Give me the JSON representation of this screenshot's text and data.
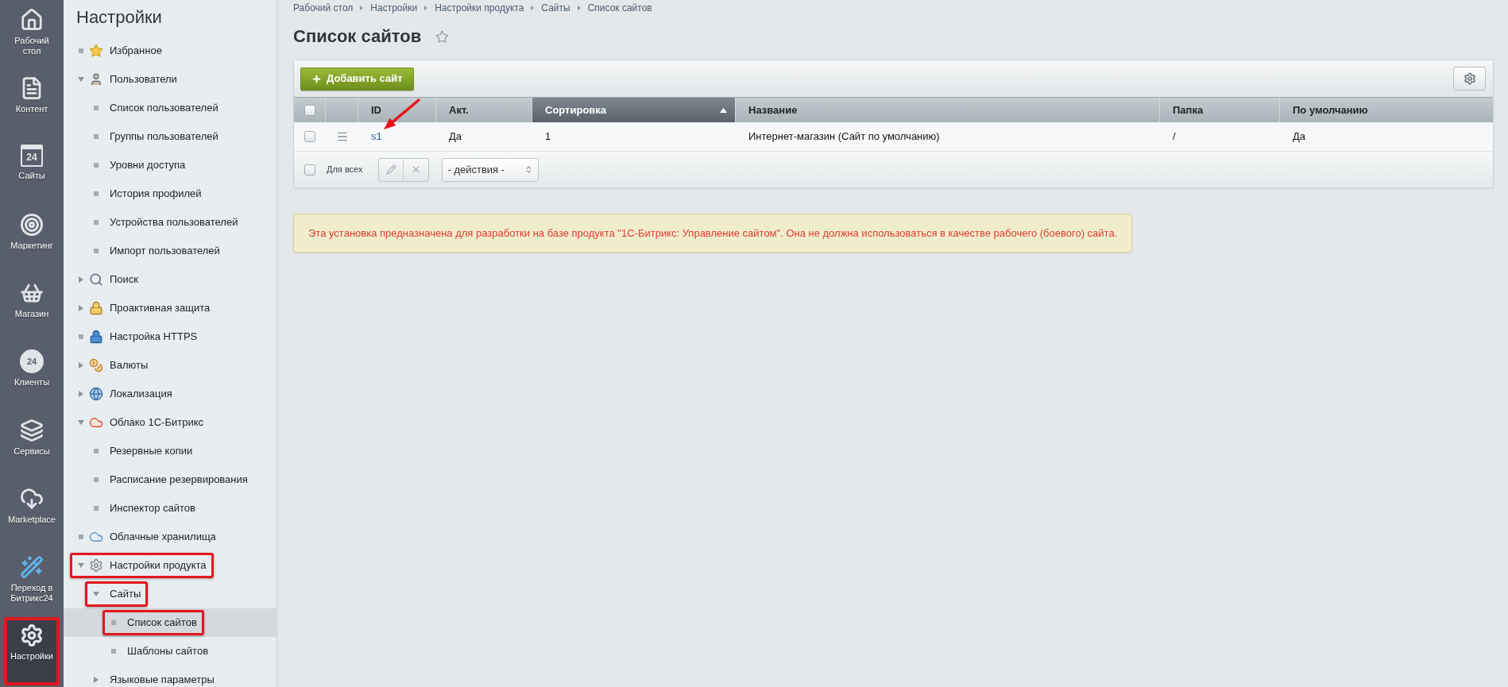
{
  "app_sidebar": {
    "items": [
      {
        "label": "Рабочий стол",
        "selected": false,
        "framed": false
      },
      {
        "label": "Контент",
        "selected": false,
        "framed": false
      },
      {
        "label": "Сайты",
        "icon_text": "24",
        "selected": false,
        "framed": false
      },
      {
        "label": "Маркетинг",
        "selected": false,
        "framed": false
      },
      {
        "label": "Магазин",
        "selected": false,
        "framed": false
      },
      {
        "label": "Клиенты",
        "icon_text": "24",
        "selected": false,
        "framed": false
      },
      {
        "label": "Сервисы",
        "selected": false,
        "framed": false
      },
      {
        "label": "Marketplace",
        "selected": false,
        "framed": false
      },
      {
        "label": "Переход в Битрикс24",
        "selected": false,
        "framed": false
      },
      {
        "label": "Настройки",
        "selected": true,
        "framed": true
      }
    ]
  },
  "settings_menu": {
    "title": "Настройки",
    "items": [
      {
        "label": "Избранное",
        "selected": false,
        "framed": false
      },
      {
        "label": "Пользователи",
        "expanded": true,
        "selected": false,
        "framed": false,
        "children": [
          {
            "label": "Список пользователей",
            "selected": false,
            "framed": false
          },
          {
            "label": "Группы пользователей",
            "selected": false,
            "framed": false
          },
          {
            "label": "Уровни доступа",
            "selected": false,
            "framed": false
          },
          {
            "label": "История профилей",
            "selected": false,
            "framed": false
          },
          {
            "label": "Устройства пользователей",
            "selected": false,
            "framed": false
          },
          {
            "label": "Импорт пользователей",
            "selected": false,
            "framed": false
          }
        ]
      },
      {
        "label": "Поиск",
        "expanded": false,
        "selected": false,
        "framed": false
      },
      {
        "label": "Проактивная защита",
        "expanded": false,
        "selected": false,
        "framed": false
      },
      {
        "label": "Настройка HTTPS",
        "selected": false,
        "framed": false
      },
      {
        "label": "Валюты",
        "expanded": false,
        "selected": false,
        "framed": false
      },
      {
        "label": "Локализация",
        "expanded": false,
        "selected": false,
        "framed": false
      },
      {
        "label": "Облако 1С-Битрикс",
        "expanded": true,
        "selected": false,
        "framed": false,
        "children": [
          {
            "label": "Резервные копии",
            "selected": false,
            "framed": false
          },
          {
            "label": "Расписание резервирования",
            "selected": false,
            "framed": false
          },
          {
            "label": "Инспектор сайтов",
            "selected": false,
            "framed": false
          }
        ]
      },
      {
        "label": "Облачные хранилища",
        "selected": false,
        "framed": false
      },
      {
        "label": "Настройки продукта",
        "expanded": true,
        "selected": false,
        "framed": true,
        "children": [
          {
            "label": "Сайты",
            "expanded": true,
            "selected": false,
            "framed": true,
            "children": [
              {
                "label": "Список сайтов",
                "selected": true,
                "framed": true
              },
              {
                "label": "Шаблоны сайтов",
                "selected": false,
                "framed": false
              }
            ]
          },
          {
            "label": "Языковые параметры",
            "expanded": false,
            "selected": false,
            "framed": false
          }
        ]
      }
    ]
  },
  "breadcrumbs": [
    "Рабочий стол",
    "Настройки",
    "Настройки продукта",
    "Сайты",
    "Список сайтов"
  ],
  "page_title": {
    "text": "Список сайтов",
    "favorite": false
  },
  "toolbar": {
    "add_button": "Добавить сайт"
  },
  "table": {
    "select_all_checked": false,
    "columns": [
      {
        "label": "ID",
        "kind": "link",
        "sorted": false
      },
      {
        "label": "Акт.",
        "kind": "text",
        "sorted": false
      },
      {
        "label": "Сортировка",
        "kind": "text",
        "sorted": true
      },
      {
        "label": "Название",
        "kind": "text",
        "sorted": false
      },
      {
        "label": "Папка",
        "kind": "text",
        "sorted": false
      },
      {
        "label": "По умолчанию",
        "kind": "text",
        "sorted": false
      }
    ],
    "rows": [
      {
        "checked": false,
        "pointer_arrow": true,
        "cells": [
          "s1",
          "Да",
          "1",
          "Интернет-магазин (Сайт по умолчанию)",
          "/",
          "Да"
        ]
      }
    ]
  },
  "group_actions": {
    "checked": false,
    "label": "Для всех",
    "action_select": "- действия -"
  },
  "notice": {
    "text": "Эта установка предназначена для разработки на базе продукта \"1С-Битрикс: Управление сайтом\". Она не должна использоваться в качестве рабочего (боевого) сайта."
  }
}
